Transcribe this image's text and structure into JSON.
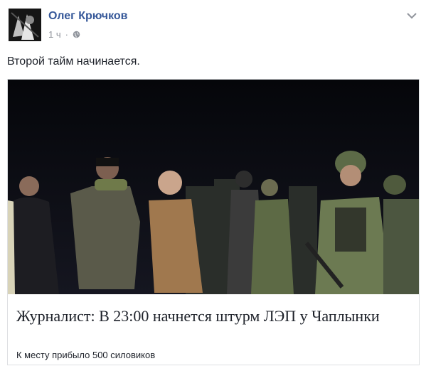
{
  "author": {
    "name": "Олег Крючков"
  },
  "post": {
    "time": "1 ч",
    "text": "Второй тайм начинается."
  },
  "link_card": {
    "title": "Журналист: В 23:00 начнется штурм ЛЭП у Чаплынки",
    "description": "К месту прибыло 500 силовиков",
    "image_alt": "Photo: group of men in military uniforms at night"
  },
  "colors": {
    "author_link": "#365899",
    "muted": "#90949c",
    "text": "#1d2129",
    "card_border": "#dddfe2"
  }
}
